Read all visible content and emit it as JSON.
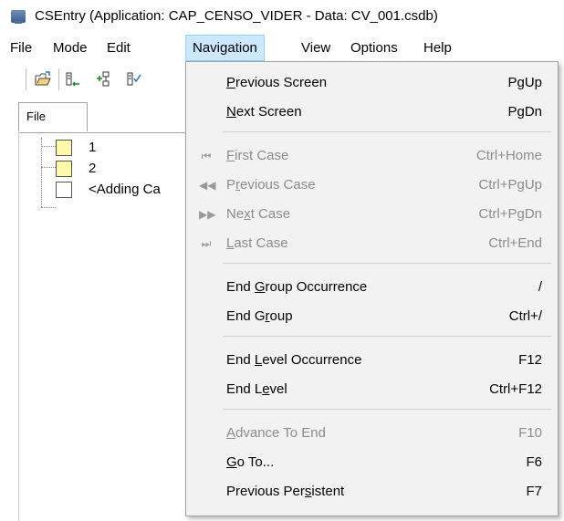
{
  "window": {
    "title": "CSEntry (Application: CAP_CENSO_VIDER - Data: CV_001.csdb)"
  },
  "menubar": {
    "items": [
      {
        "label": "File"
      },
      {
        "label": "Mode"
      },
      {
        "label": "Edit"
      },
      {
        "label": "Navigation"
      },
      {
        "label": "View"
      },
      {
        "label": "Options"
      },
      {
        "label": "Help"
      }
    ]
  },
  "toolbar": {
    "icons": [
      "open-folder-icon",
      "insert-node-icon",
      "add-node-icon",
      "verify-icon"
    ]
  },
  "tabs": {
    "file": "File"
  },
  "tree": {
    "items": [
      {
        "label": "1",
        "color": "#fff9a8"
      },
      {
        "label": "2",
        "color": "#fff9a8"
      },
      {
        "label": "<Adding Ca",
        "color": "#ffffff"
      }
    ]
  },
  "navigation_menu": {
    "items": [
      {
        "pre": "",
        "u": "P",
        "post": "revious Screen",
        "shortcut": "PgUp",
        "disabled": false,
        "icon": ""
      },
      {
        "pre": "",
        "u": "N",
        "post": "ext Screen",
        "shortcut": "PgDn",
        "disabled": false,
        "icon": ""
      },
      {
        "pre": "",
        "u": "F",
        "post": "irst Case",
        "shortcut": "Ctrl+Home",
        "disabled": true,
        "icon": "⏮"
      },
      {
        "pre": "P",
        "u": "r",
        "post": "evious Case",
        "shortcut": "Ctrl+PgUp",
        "disabled": true,
        "icon": "◀◀"
      },
      {
        "pre": "Ne",
        "u": "x",
        "post": "t Case",
        "shortcut": "Ctrl+PgDn",
        "disabled": true,
        "icon": "▶▶"
      },
      {
        "pre": "",
        "u": "L",
        "post": "ast Case",
        "shortcut": "Ctrl+End",
        "disabled": true,
        "icon": "⏭"
      },
      {
        "pre": "End ",
        "u": "G",
        "post": "roup Occurrence",
        "shortcut": "/",
        "disabled": false,
        "icon": ""
      },
      {
        "pre": "End G",
        "u": "r",
        "post": "oup",
        "shortcut": "Ctrl+/",
        "disabled": false,
        "icon": ""
      },
      {
        "pre": "End ",
        "u": "L",
        "post": "evel Occurrence",
        "shortcut": "F12",
        "disabled": false,
        "icon": ""
      },
      {
        "pre": "End L",
        "u": "e",
        "post": "vel",
        "shortcut": "Ctrl+F12",
        "disabled": false,
        "icon": ""
      },
      {
        "pre": "",
        "u": "A",
        "post": "dvance To End",
        "shortcut": "F10",
        "disabled": true,
        "icon": ""
      },
      {
        "pre": "",
        "u": "G",
        "post": "o To...",
        "shortcut": "F6",
        "disabled": false,
        "icon": ""
      },
      {
        "pre": "Previous Per",
        "u": "s",
        "post": "istent",
        "shortcut": "F7",
        "disabled": false,
        "icon": ""
      }
    ]
  }
}
